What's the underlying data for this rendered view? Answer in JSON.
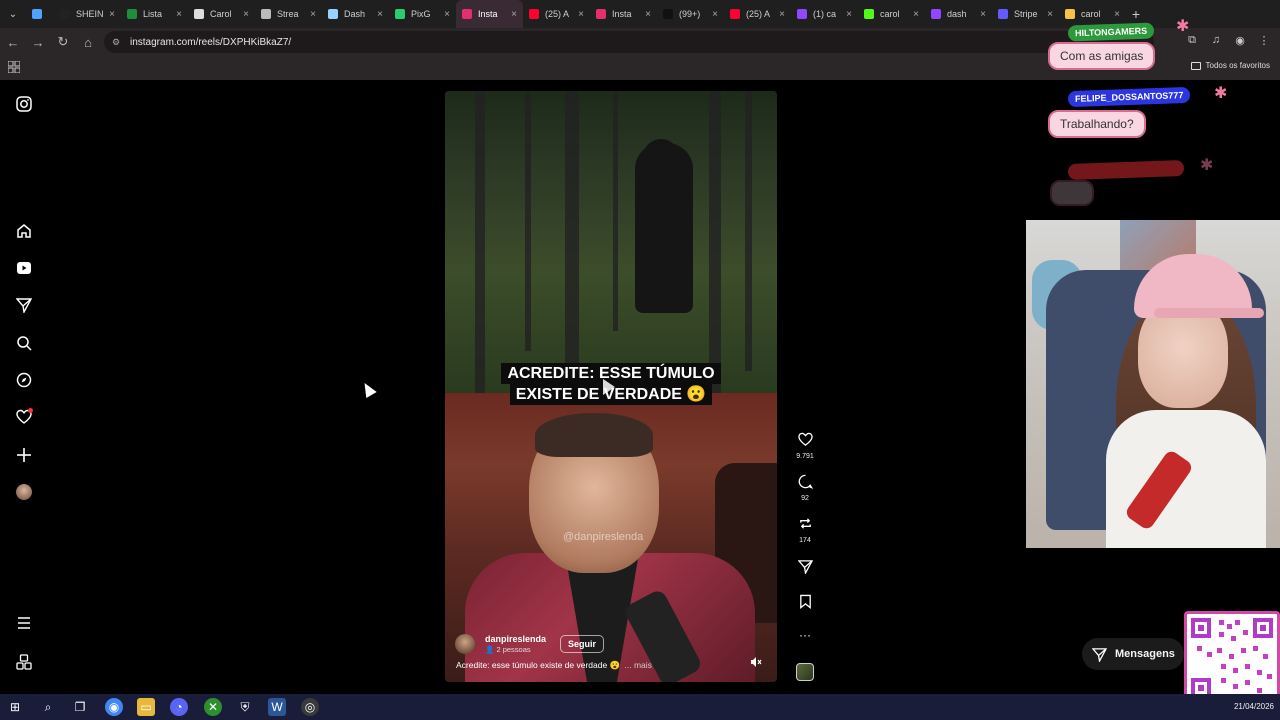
{
  "browser": {
    "tabs": [
      {
        "label": "",
        "color": "#4ea3ff"
      },
      {
        "label": "SHEIN",
        "color": "#222222"
      },
      {
        "label": "Lista",
        "color": "#1e8e3e"
      },
      {
        "label": "Carol",
        "color": "#dddddd"
      },
      {
        "label": "Strea",
        "color": "#bbbbbb"
      },
      {
        "label": "Dash",
        "color": "#9ad0ff"
      },
      {
        "label": "PixG",
        "color": "#2ecc71"
      },
      {
        "label": "Insta",
        "color": "#e1306c",
        "active": true
      },
      {
        "label": "(25) A",
        "color": "#ff0033"
      },
      {
        "label": "Insta",
        "color": "#e1306c"
      },
      {
        "label": "(99+)",
        "color": "#111111"
      },
      {
        "label": "(25) A",
        "color": "#ff0033"
      },
      {
        "label": "(1) ca",
        "color": "#9146ff"
      },
      {
        "label": "carol",
        "color": "#53fc18"
      },
      {
        "label": "dash",
        "color": "#9146ff"
      },
      {
        "label": "Stripe",
        "color": "#635bff"
      },
      {
        "label": "carol",
        "color": "#f5c542"
      }
    ],
    "url": "instagram.com/reels/DXPHKiBkaZ7/",
    "all_favorites": "Todos os favoritos"
  },
  "reel": {
    "caption_overlay_line1": "ACREDITE: ESSE TÚMULO",
    "caption_overlay_line2": "EXISTE DE VERDADE 😮",
    "watermark": "@danpireslenda",
    "author": "danpireslenda",
    "people": "2 pessoas",
    "follow_label": "Seguir",
    "caption": "Acredite: esse túmulo existe de verdade 😮",
    "more_label": "... mais"
  },
  "actions": {
    "likes": "9.791",
    "comments": "92",
    "reposts": "174"
  },
  "stream_overlay": {
    "chat": [
      {
        "name": "HILTONGAMERS",
        "message": "Com as amigas"
      },
      {
        "name": "FELIPE_DOSSANTOS777",
        "message": "Trabalhando?"
      }
    ],
    "messages_label": "Mensagens"
  },
  "taskbar": {
    "date": "21/04/2026"
  },
  "colors": {
    "accent_pink": "#f27ba5",
    "notification_red": "#ff3040"
  }
}
